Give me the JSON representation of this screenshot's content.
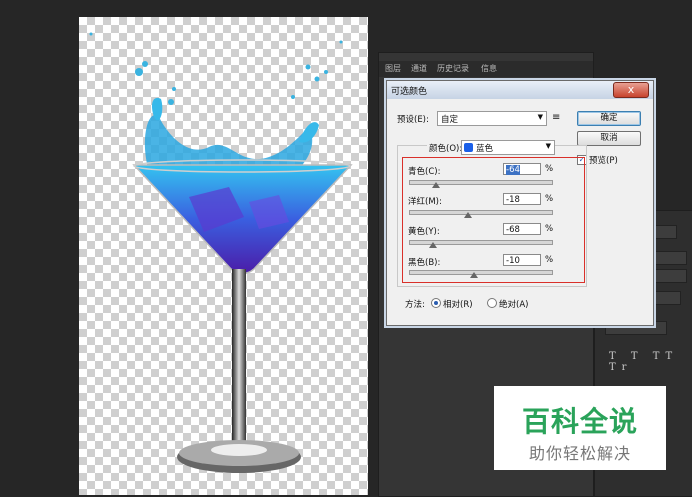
{
  "panel": {
    "tabs": [
      "图层",
      "通道",
      "历史记录",
      "信息"
    ],
    "char_buttons": "T T TT Tr"
  },
  "dialog": {
    "title": "可选颜色",
    "close_glyph": "x",
    "preset_label": "预设(E):",
    "preset_value": "自定",
    "preset_menu_icon": "≡",
    "ok_label": "确定",
    "cancel_label": "取消",
    "preview_label": "预览(P)",
    "preview_checked": true,
    "colors_label": "颜色(O):",
    "colors_value": "蓝色",
    "colors_swatch": "#1a5fe8",
    "sliders": [
      {
        "label": "青色(C):",
        "value": "-64",
        "unit": "%",
        "level": -64
      },
      {
        "label": "洋红(M):",
        "value": "-18",
        "unit": "%",
        "level": -18
      },
      {
        "label": "黄色(Y):",
        "value": "-68",
        "unit": "%",
        "level": -68
      },
      {
        "label": "黑色(B):",
        "value": "-10",
        "unit": "%",
        "level": -10
      }
    ],
    "method_label": "方法:",
    "method_relative": "相对(R)",
    "method_absolute": "绝对(A)",
    "method_selected": "relative"
  },
  "watermark": {
    "title": "百科全说",
    "subtitle": "助你轻松解决"
  },
  "colors": {
    "highlight": "#d9302a",
    "watermark_green": "#2aa35a"
  }
}
